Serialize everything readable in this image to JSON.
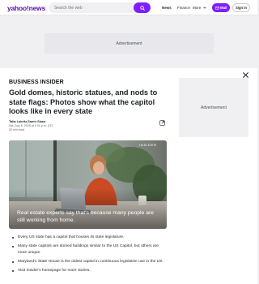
{
  "header": {
    "logo": "yahoo!news",
    "search_placeholder": "Search the web",
    "nav": [
      "News",
      "Finance",
      "More"
    ],
    "mail_label": "Mail",
    "signin_label": "Sign in"
  },
  "ads": {
    "top": "Advertisement",
    "side": "Advertisement"
  },
  "article": {
    "publisher": "BUSINESS INSIDER",
    "headline": "Gold domes, historic statues, and nods to state flags: Photos show what the capitol looks like in every state",
    "author": "Talia Lakritz,Samir Shaw",
    "date": "Sat, July 5, 2025 at 1:01 p.m. UTC",
    "read_time": "30 min read",
    "image": {
      "watermark": "INSIDER",
      "caption": "Real estate experts say that's because many people are still working from home."
    },
    "bullets": [
      "Every US state has a capitol that houses its state legislature.",
      "Many state capitols are domed buildings similar to the US Capitol, but others are more unique.",
      "Maryland's State House is the oldest capitol in continuous legislative use in the US.",
      "Visit Insider's homepage for more stories."
    ]
  },
  "colors": {
    "brand": "#7e1fff",
    "logo": "#5b0ca8"
  },
  "icons": [
    "search-icon",
    "mail-icon",
    "chevron-down-icon",
    "close-icon",
    "share-icon"
  ]
}
